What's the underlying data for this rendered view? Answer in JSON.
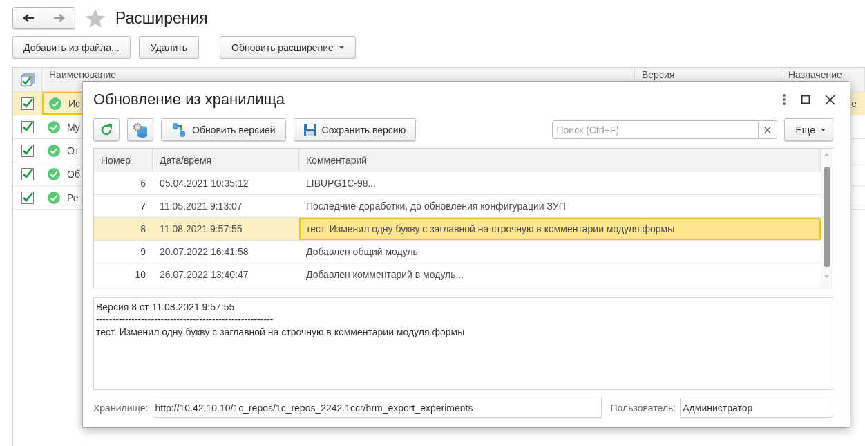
{
  "page": {
    "title": "Расширения",
    "starred": false
  },
  "toolbar": [
    {
      "label": "Добавить из файла...",
      "kind": "plain"
    },
    {
      "label": "Удалить",
      "kind": "plain"
    },
    {
      "label": "Обновить расширение",
      "kind": "dropdown"
    }
  ],
  "extensions_table": {
    "all_checked": true,
    "columns": [
      "Наименование",
      "Версия",
      "Назначение"
    ],
    "rows": [
      {
        "checked": true,
        "name": "Ис",
        "column_3": "е",
        "selected": true
      },
      {
        "checked": true,
        "name": "Му",
        "selected": false
      },
      {
        "checked": true,
        "name": "От",
        "selected": false
      },
      {
        "checked": true,
        "name": "Об",
        "selected": false
      },
      {
        "checked": true,
        "name": "Ре",
        "selected": false
      }
    ]
  },
  "dialog": {
    "title": "Обновление из хранилища",
    "toolbar": [
      {
        "kind": "refresh"
      },
      {
        "kind": "settings"
      },
      {
        "kind": "update",
        "label": "Обновить версией"
      },
      {
        "kind": "save",
        "label": "Сохранить версию"
      }
    ],
    "search": {
      "placeholder": "Поиск (Ctrl+F)"
    },
    "more_button": "Еще",
    "table": {
      "columns": [
        "Номер",
        "Дата/время",
        "Комментарий"
      ],
      "rows": [
        {
          "number": "6",
          "datetime": "05.04.2021 10:35:12",
          "comment": "LIBUPG1C-98...",
          "selected": false
        },
        {
          "number": "7",
          "datetime": "11.05.2021 9:13:07",
          "comment": "Последние доработки, до обновления конфигурации ЗУП",
          "selected": false
        },
        {
          "number": "8",
          "datetime": "11.08.2021 9:57:55",
          "comment": "тест. Изменил одну букву с заглавной на строчную в комментарии модуля формы",
          "selected": true
        },
        {
          "number": "9",
          "datetime": "20.07.2022 16:41:58",
          "comment": "Добавлен общий модуль",
          "selected": false
        },
        {
          "number": "10",
          "datetime": "26.07.2022 13:40:47",
          "comment": "Добавлен комментарий в модуль...",
          "selected": false
        }
      ]
    },
    "details": [
      "Версия 8 от 11.08.2021 9:57:55",
      "-------------------------------------------------------",
      "тест. Изменил одну букву с заглавной на строчную в комментарии модуля формы"
    ],
    "storage": {
      "label": "Хранилище:",
      "value": "http://10.42.10.10/1c_repos/1c_repos_2242.1ccr/hrm_export_experiments"
    },
    "user": {
      "label": "Пользователь:",
      "value": "Администратор"
    }
  }
}
